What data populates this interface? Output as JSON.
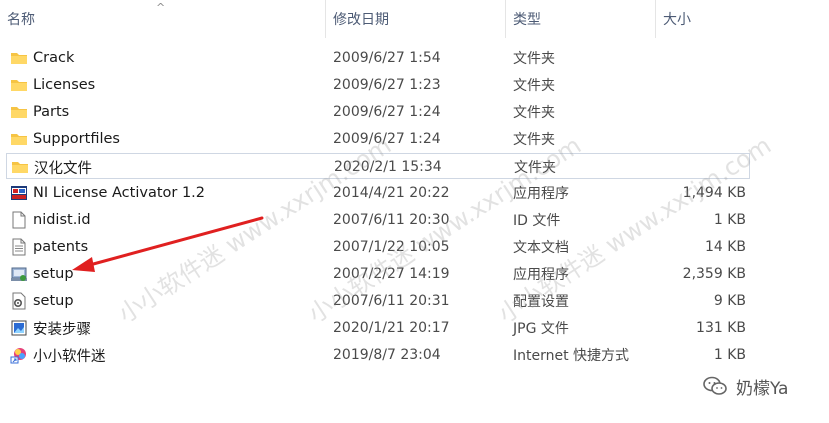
{
  "header": {
    "name": "名称",
    "date": "修改日期",
    "type": "类型",
    "size": "大小",
    "sort_indicator": "^"
  },
  "files": [
    {
      "name": "Crack",
      "date": "2009/6/27 1:54",
      "type": "文件夹",
      "size": "",
      "icon": "folder-icon"
    },
    {
      "name": "Licenses",
      "date": "2009/6/27 1:23",
      "type": "文件夹",
      "size": "",
      "icon": "folder-icon"
    },
    {
      "name": "Parts",
      "date": "2009/6/27 1:24",
      "type": "文件夹",
      "size": "",
      "icon": "folder-icon"
    },
    {
      "name": "Supportfiles",
      "date": "2009/6/27 1:24",
      "type": "文件夹",
      "size": "",
      "icon": "folder-icon"
    },
    {
      "name": "汉化文件",
      "date": "2020/2/1 15:34",
      "type": "文件夹",
      "size": "",
      "icon": "folder-icon"
    },
    {
      "name": "NI License Activator 1.2",
      "date": "2014/4/21 20:22",
      "type": "应用程序",
      "size": "1,494 KB",
      "icon": "activator-app-icon"
    },
    {
      "name": "nidist.id",
      "date": "2007/6/11 20:30",
      "type": "ID 文件",
      "size": "1 KB",
      "icon": "document-icon"
    },
    {
      "name": "patents",
      "date": "2007/1/22 10:05",
      "type": "文本文档",
      "size": "14 KB",
      "icon": "text-document-icon"
    },
    {
      "name": "setup",
      "date": "2007/2/27 14:19",
      "type": "应用程序",
      "size": "2,359 KB",
      "icon": "setup-app-icon"
    },
    {
      "name": "setup",
      "date": "2007/6/11 20:31",
      "type": "配置设置",
      "size": "9 KB",
      "icon": "config-settings-icon"
    },
    {
      "name": "安装步骤",
      "date": "2020/1/21 20:17",
      "type": "JPG 文件",
      "size": "131 KB",
      "icon": "image-file-icon"
    },
    {
      "name": "小小软件迷",
      "date": "2019/8/7 23:04",
      "type": "Internet 快捷方式",
      "size": "1 KB",
      "icon": "internet-shortcut-icon"
    }
  ],
  "watermarks": [
    "小小软件迷 www.xxrjm.com",
    "小小软件迷 www.xxrjm.com",
    "小小软件迷 www.xxrjm.com"
  ],
  "badge": {
    "text": "奶檬Ya",
    "icon": "wechat-icon"
  },
  "colors": {
    "folder": "#f6c444",
    "arrow": "#e02020",
    "header_text": "#4d5b75"
  }
}
